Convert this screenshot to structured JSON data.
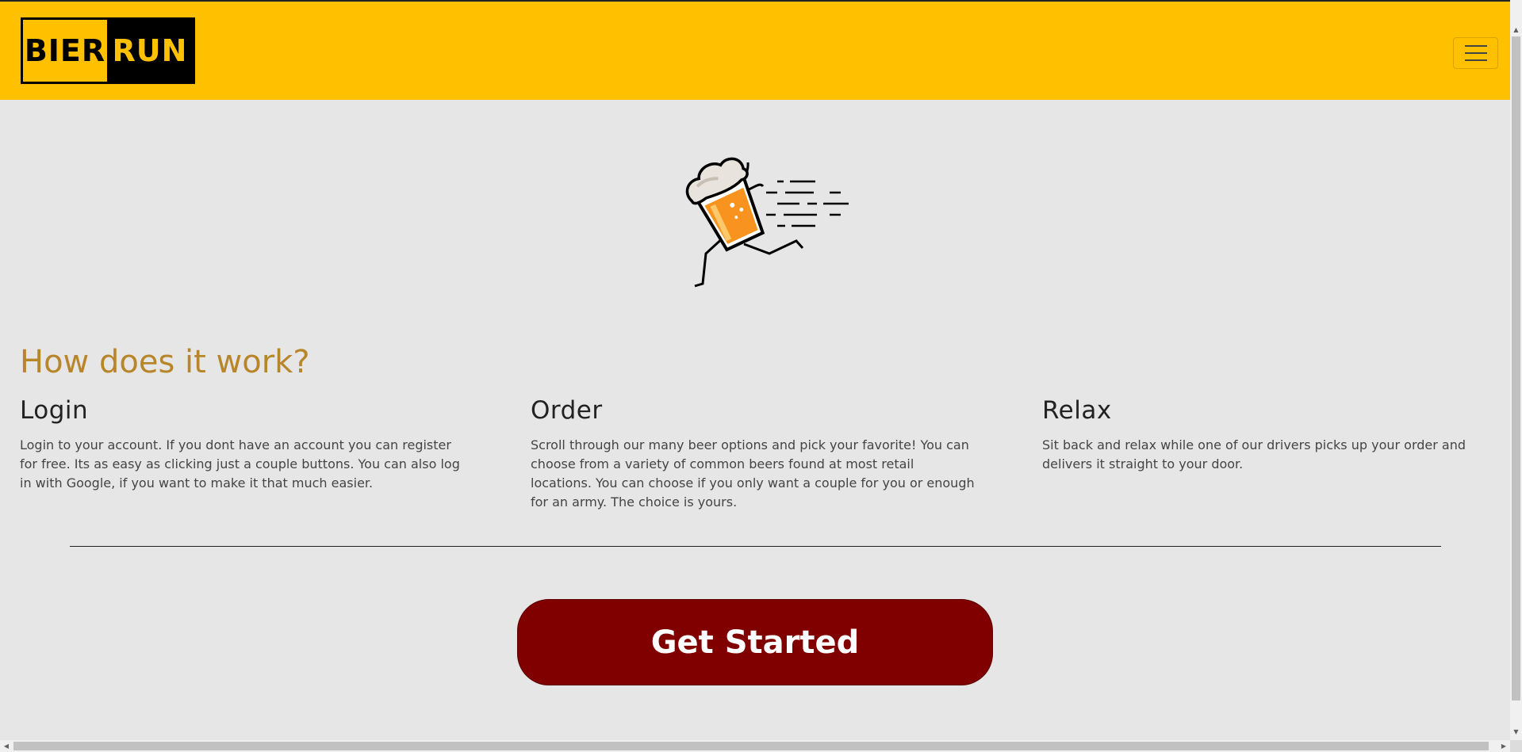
{
  "navbar": {
    "logo_left": "BIER",
    "logo_right": "RUN",
    "menu_icon": "hamburger-menu-icon",
    "bg_color": "#ffc000"
  },
  "hero": {
    "image": "running-beer-mug-illustration"
  },
  "section": {
    "title": "How does it work?",
    "steps": [
      {
        "heading": "Login",
        "text": "Login to your account. If you dont have an account you can register for free. Its as easy as clicking just a couple buttons. You can also log in with Google, if you want to make it that much easier."
      },
      {
        "heading": "Order",
        "text": "Scroll through our many beer options and pick your favorite! You can choose from a variety of common beers found at most retail locations. You can choose if you only want a couple for you or enough for an army. The choice is yours."
      },
      {
        "heading": "Relax",
        "text": "Sit back and relax while one of our drivers picks up your order and delivers it straight to your door."
      }
    ]
  },
  "cta": {
    "label": "Get Started",
    "color": "#800000"
  },
  "colors": {
    "accent": "#ffc000",
    "title": "#b8862a",
    "background": "#e6e6e6"
  }
}
